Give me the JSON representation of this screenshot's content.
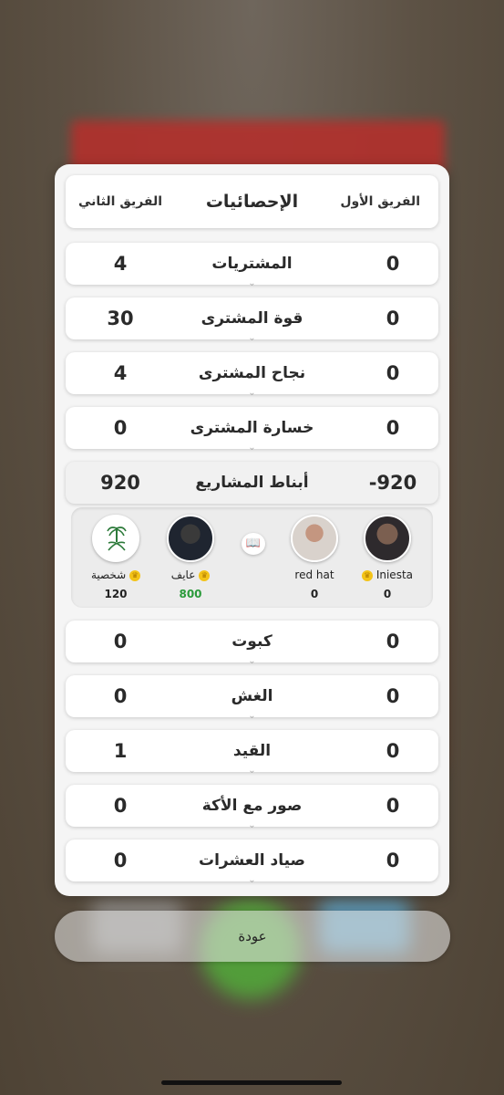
{
  "header": {
    "team_one": "الفريق الأول",
    "title": "الإحصائيات",
    "team_two": "الفريق الثاني"
  },
  "stats": [
    {
      "label": "المشتريات",
      "team_one": "0",
      "team_two": "4"
    },
    {
      "label": "قوة المشترى",
      "team_one": "0",
      "team_two": "30"
    },
    {
      "label": "نجاح المشترى",
      "team_one": "0",
      "team_two": "4"
    },
    {
      "label": "خسارة المشترى",
      "team_one": "0",
      "team_two": "0"
    },
    {
      "label": "أبناط المشاريع",
      "team_one": "-920",
      "team_two": "920"
    },
    {
      "label": "كبوت",
      "team_one": "0",
      "team_two": "0"
    },
    {
      "label": "الغش",
      "team_one": "0",
      "team_two": "0"
    },
    {
      "label": "القيد",
      "team_one": "0",
      "team_two": "1"
    },
    {
      "label": "صور مع الأكة",
      "team_one": "0",
      "team_two": "0"
    },
    {
      "label": "صياد العشرات",
      "team_one": "0",
      "team_two": "0"
    }
  ],
  "players": [
    {
      "name": "Iniesta",
      "score": "0",
      "crown": true,
      "avatar": "chimp-avatar"
    },
    {
      "name": "red hat",
      "score": "0",
      "crown": false,
      "avatar": "man-avatar"
    },
    {
      "name": "عايف",
      "score": "800",
      "crown": true,
      "avatar": "player-avatar"
    },
    {
      "name": "شخصية",
      "score": "120",
      "crown": true,
      "avatar": "saudi-emblem-avatar"
    }
  ],
  "back_button": "عودة",
  "colors": {
    "green_score": "#2a9a3a",
    "crown": "#f3c318"
  }
}
